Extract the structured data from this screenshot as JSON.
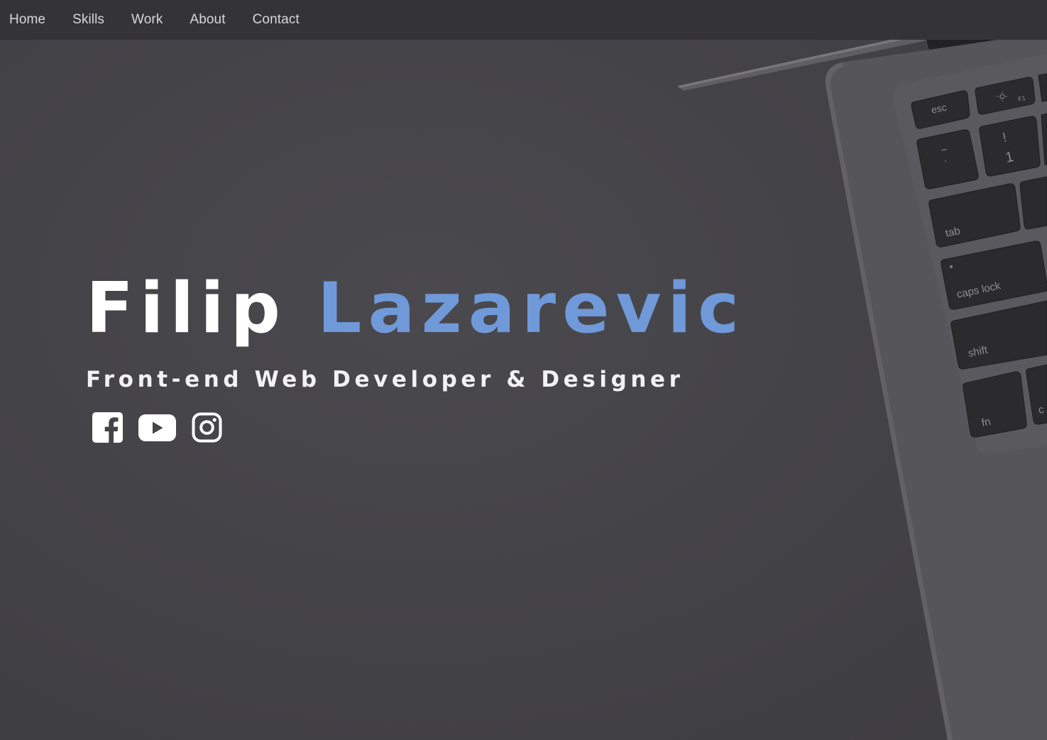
{
  "nav": {
    "items": [
      {
        "label": "Home"
      },
      {
        "label": "Skills"
      },
      {
        "label": "Work"
      },
      {
        "label": "About"
      },
      {
        "label": "Contact"
      }
    ]
  },
  "hero": {
    "first_name": "Filip",
    "last_name": "Lazarevic",
    "subtitle": "Front-end Web Developer & Designer"
  },
  "social": [
    {
      "icon": "facebook-icon"
    },
    {
      "icon": "youtube-icon"
    },
    {
      "icon": "instagram-icon"
    }
  ],
  "keyboard": {
    "keys": [
      "esc",
      "F1",
      "~",
      "`",
      "!",
      "1",
      "tab",
      "caps lock",
      "shift",
      "fn",
      "c"
    ]
  },
  "colors": {
    "accent": "#6f99d8",
    "nav_bg": "#343437",
    "page_bg": "#434247",
    "text": "#ffffff"
  }
}
